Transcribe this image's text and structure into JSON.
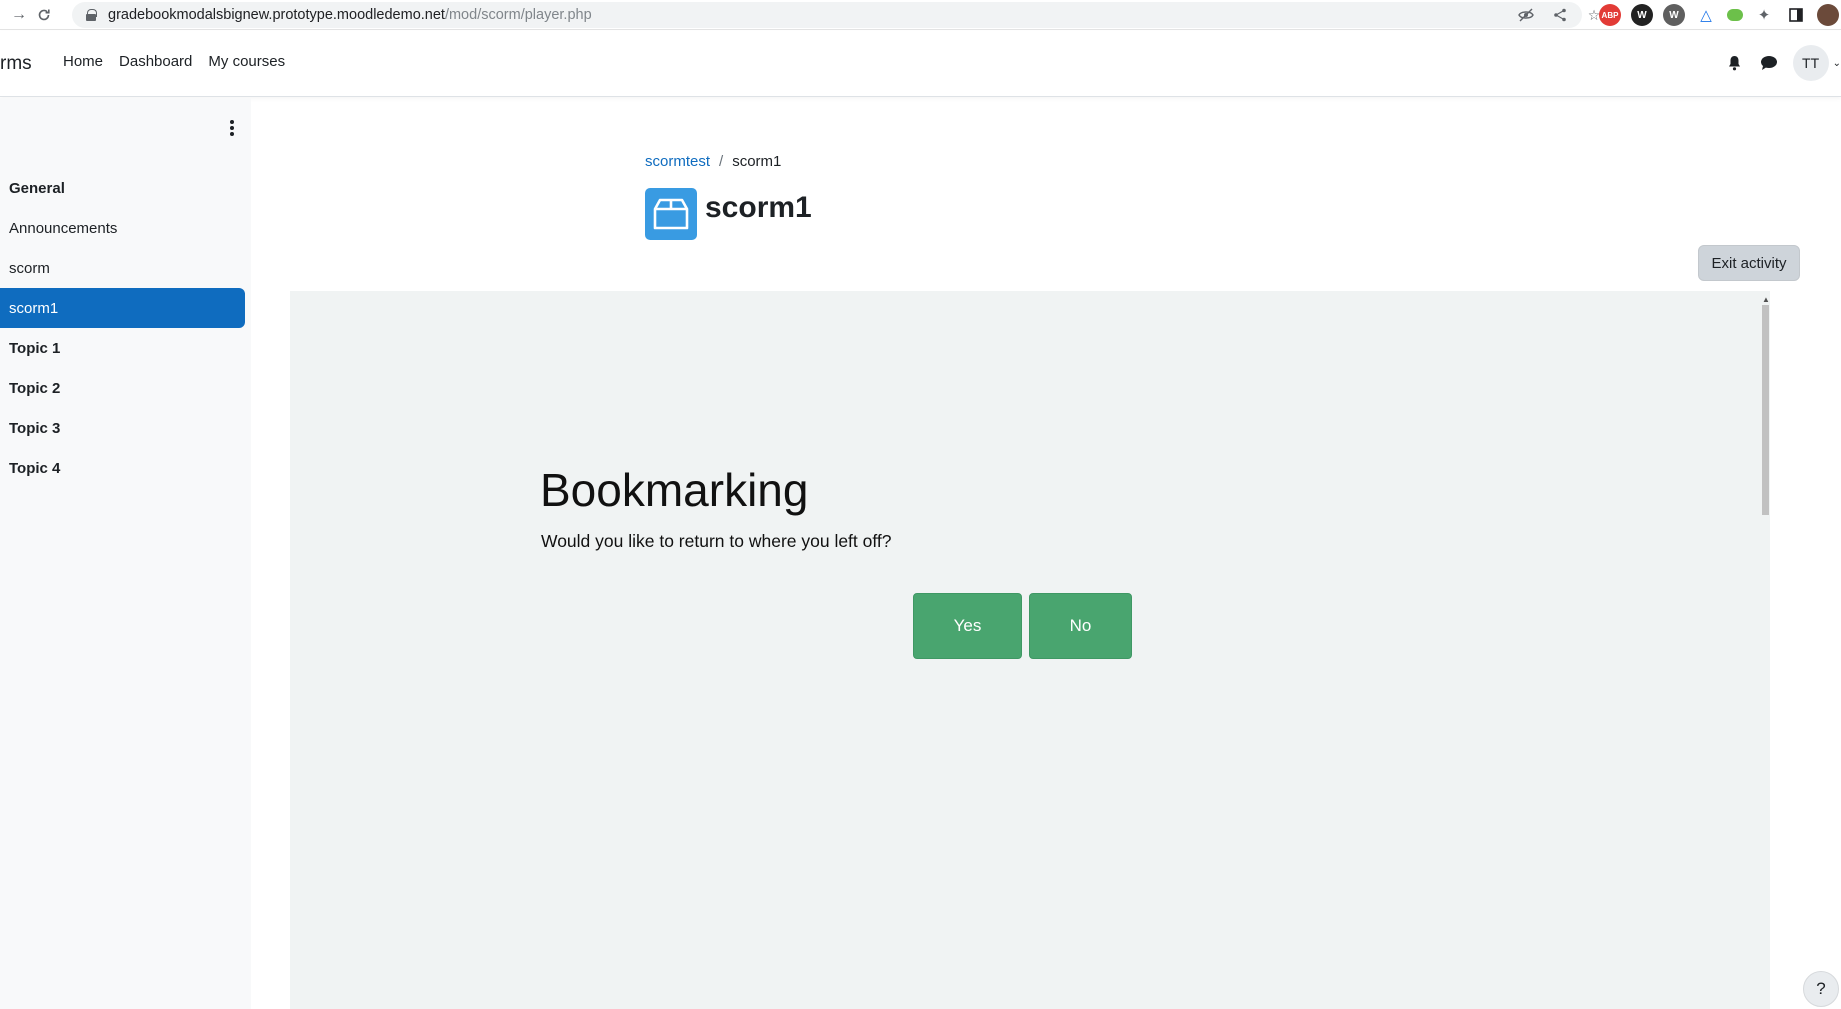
{
  "browser": {
    "url_host": "gradebookmodalsbignew.prototype.moodledemo.net",
    "url_path": "/mod/scorm/player.php",
    "extensions": [
      {
        "name": "adblock-plus-icon",
        "label": "ABP",
        "color": "#e23b36"
      },
      {
        "name": "extension-w-dark-icon",
        "label": "W",
        "color": "#222222"
      },
      {
        "name": "wordpress-icon",
        "label": "W",
        "color": "#555555"
      },
      {
        "name": "delta-icon",
        "label": "△",
        "color": "#1a73e8"
      },
      {
        "name": "green-extension-icon",
        "label": "",
        "color": "#4caf50"
      }
    ]
  },
  "navbar": {
    "brand": "rms",
    "links": [
      "Home",
      "Dashboard",
      "My courses"
    ],
    "user_initials": "TT"
  },
  "course_index": {
    "items": [
      {
        "label": "General",
        "type": "section"
      },
      {
        "label": "Announcements",
        "type": "activity"
      },
      {
        "label": "scorm",
        "type": "activity"
      },
      {
        "label": "scorm1",
        "type": "activity",
        "active": true
      },
      {
        "label": "Topic 1",
        "type": "section"
      },
      {
        "label": "Topic 2",
        "type": "section"
      },
      {
        "label": "Topic 3",
        "type": "section"
      },
      {
        "label": "Topic 4",
        "type": "section"
      }
    ]
  },
  "breadcrumb": {
    "parent": "scormtest",
    "separator": "/",
    "current": "scorm1"
  },
  "page": {
    "title": "scorm1",
    "exit_label": "Exit activity",
    "icon_color": "#399be2"
  },
  "player": {
    "heading": "Bookmarking",
    "question": "Would you like to return to where you left off?",
    "yes_label": "Yes",
    "no_label": "No",
    "button_color": "#49a56f"
  },
  "help": {
    "label": "?"
  }
}
